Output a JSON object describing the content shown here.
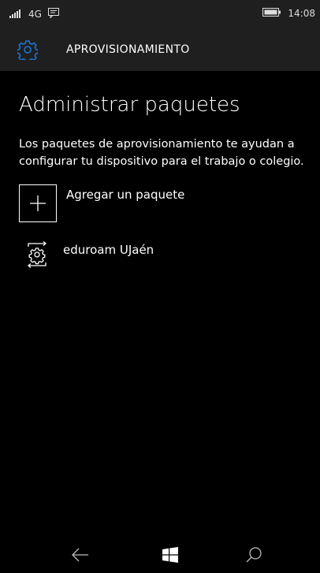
{
  "status": {
    "network": "4G",
    "time": "14:08"
  },
  "header": {
    "title": "APROVISIONAMIENTO"
  },
  "main": {
    "title": "Administrar paquetes",
    "description": "Los paquetes de aprovisionamiento te ayudan a configurar tu dispositivo para el trabajo o colegio.",
    "add_label": "Agregar un paquete",
    "packages": [
      {
        "label": "eduroam UJaén"
      }
    ]
  },
  "colors": {
    "accent": "#1e73d2",
    "bar": "#1f1f1f"
  },
  "icons": {
    "signal": "signal-icon",
    "message": "message-icon",
    "battery": "battery-icon",
    "settings": "gear-icon",
    "add": "plus-icon",
    "package": "package-icon",
    "back": "back-arrow-icon",
    "start": "windows-icon",
    "search": "search-icon"
  }
}
